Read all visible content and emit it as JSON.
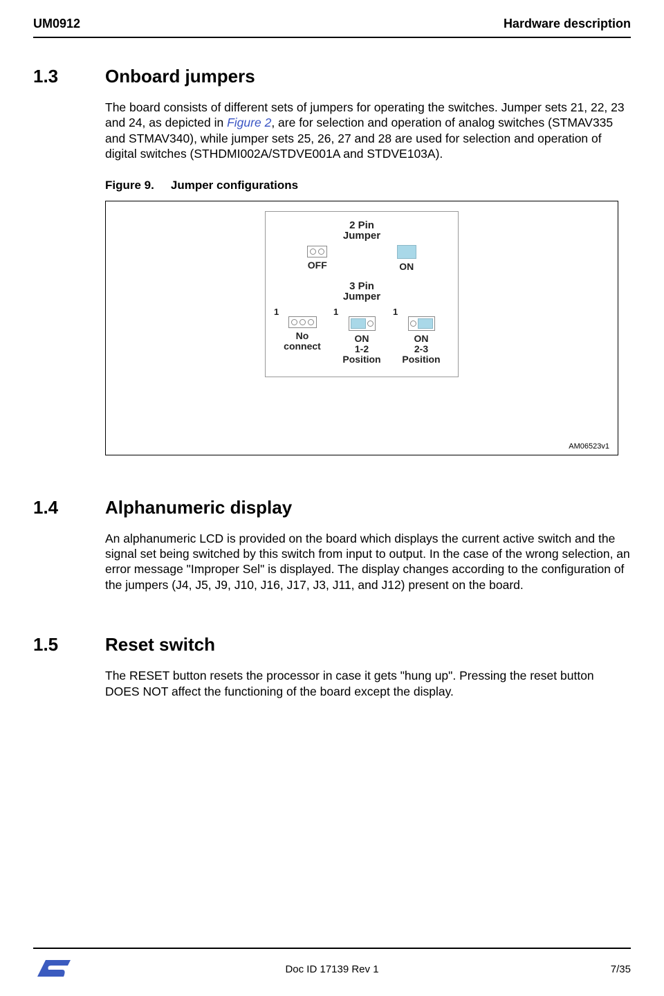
{
  "header": {
    "docnum": "UM0912",
    "section": "Hardware description"
  },
  "s13": {
    "num": "1.3",
    "title": "Onboard jumpers",
    "para_a": "The board consists of different sets of jumpers for operating the switches. Jumper sets 21, 22, 23 and 24, as depicted in ",
    "figref": "Figure 2",
    "para_b": ", are for selection and operation of analog switches (STMAV335 and STMAV340), while jumper sets 25, 26, 27 and 28 are used for selection and operation of digital switches (STHDMI002A/STDVE001A and STDVE103A)."
  },
  "figure": {
    "label": "Figure 9.",
    "caption": "Jumper configurations",
    "two_pin": "2 Pin\nJumper",
    "three_pin": "3 Pin\nJumper",
    "off": "OFF",
    "on": "ON",
    "one": "1",
    "noconnect": "No\nconnect",
    "on12": "ON\n1-2\nPosition",
    "on23": "ON\n2-3\nPosition",
    "amref": "AM06523v1"
  },
  "s14": {
    "num": "1.4",
    "title": "Alphanumeric display",
    "para": "An alphanumeric LCD is provided on the board which displays the current active switch and the signal set being switched by this switch from input to output. In the case of the wrong selection, an error message \"Improper Sel\" is displayed. The display changes according to the configuration of the jumpers (J4, J5, J9, J10, J16, J17, J3, J11, and J12) present on the board."
  },
  "s15": {
    "num": "1.5",
    "title": "Reset switch",
    "para": "The RESET button resets the processor in case it gets \"hung up\". Pressing the reset button DOES NOT affect the functioning of the board except the display."
  },
  "footer": {
    "docid": "Doc ID 17139 Rev 1",
    "page": "7/35"
  }
}
